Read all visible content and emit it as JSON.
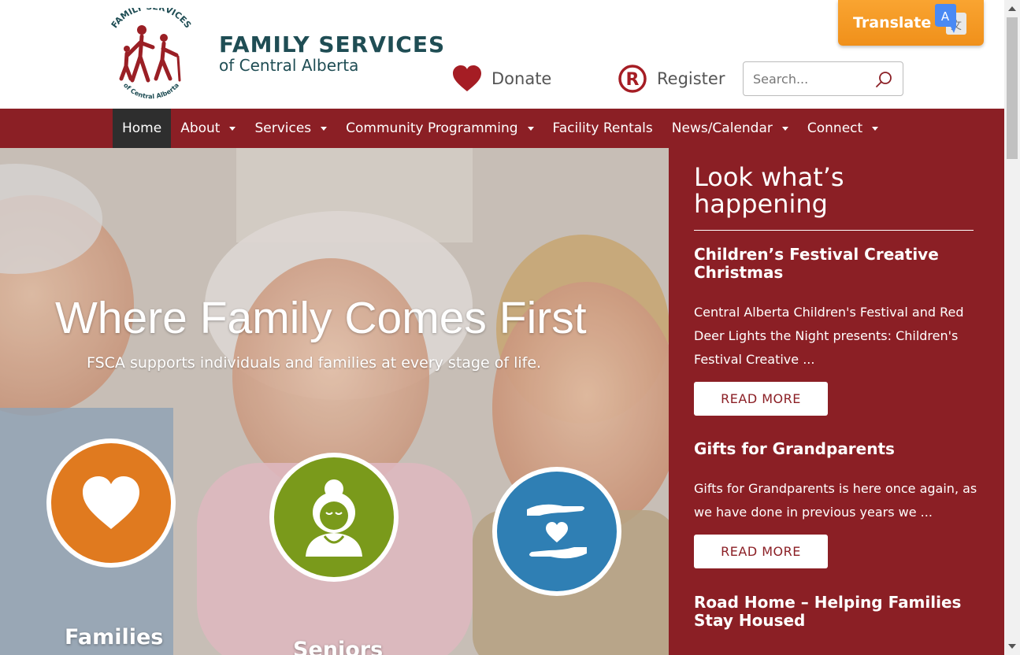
{
  "header": {
    "logo": {
      "emblem_text_top": "FAMILY SERVICES",
      "emblem_text_bottom": "of Central Alberta",
      "title": "FAMILY SERVICES",
      "subtitle": "of Central Alberta"
    },
    "donate_label": "Donate",
    "register_label": "Register",
    "search": {
      "placeholder": "Search..."
    },
    "translate_label": "Translate"
  },
  "nav": {
    "items": [
      {
        "label": "Home",
        "active": true,
        "has_dropdown": false
      },
      {
        "label": "About",
        "active": false,
        "has_dropdown": true
      },
      {
        "label": "Services",
        "active": false,
        "has_dropdown": true
      },
      {
        "label": "Community Programming",
        "active": false,
        "has_dropdown": true
      },
      {
        "label": "Facility Rentals",
        "active": false,
        "has_dropdown": false
      },
      {
        "label": "News/Calendar",
        "active": false,
        "has_dropdown": true
      },
      {
        "label": "Connect",
        "active": false,
        "has_dropdown": true
      }
    ]
  },
  "hero": {
    "title": "Where Family Comes First",
    "subtitle": "FSCA supports individuals and families at every stage of life.",
    "circles": [
      {
        "label": "Families",
        "icon": "heart-icon",
        "color": "#e07a1f"
      },
      {
        "label": "Seniors",
        "icon": "senior-woman-icon",
        "color": "#7a9a1b"
      },
      {
        "label": "",
        "icon": "hands-heart-icon",
        "color": "#2f7fb4"
      }
    ]
  },
  "sidebar": {
    "heading": "Look what’s happening",
    "posts": [
      {
        "title": "Children’s Festival Creative Christmas",
        "excerpt": "Central Alberta Children's Festival and Red Deer Lights the Night presents: Children's Festival Creative ...",
        "button": "READ MORE"
      },
      {
        "title": "Gifts for Grandparents",
        "excerpt": "Gifts for Grandparents is here once again, as we have done in previous years we ...",
        "button": "READ MORE"
      },
      {
        "title": "Road Home – Helping Families Stay Housed",
        "excerpt": "",
        "button": ""
      }
    ]
  },
  "colors": {
    "brand_red": "#8b1f25",
    "brand_teal": "#1f4d54",
    "translate_orange": "#f39a23",
    "nav_active_bg": "#2e2e2e"
  }
}
